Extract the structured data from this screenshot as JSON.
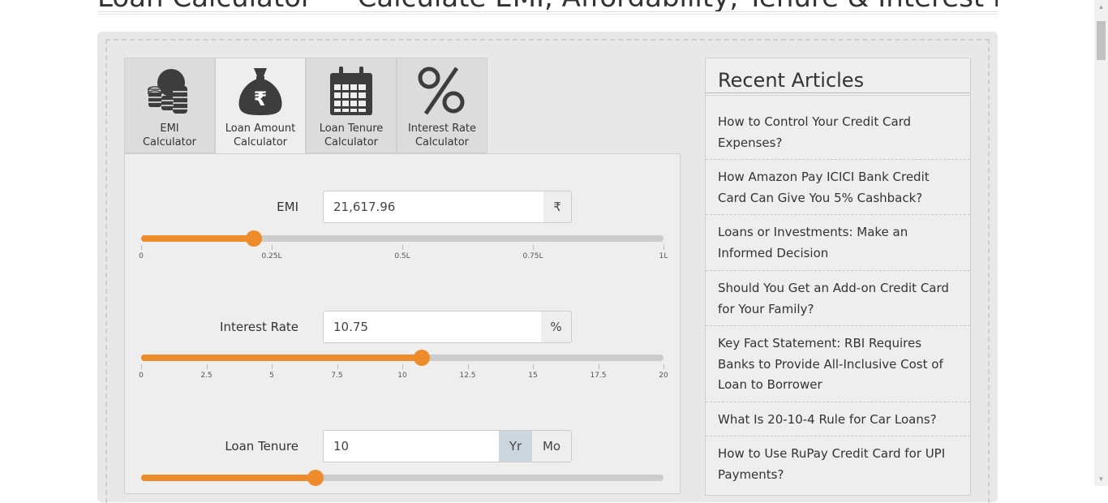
{
  "page": {
    "title": "Loan Calculator — Calculate EMI, Affordability, Tenure & Interest Rate"
  },
  "tabs": [
    {
      "label": "EMI\nCalculator",
      "icon": "coins-stack-icon",
      "active": false
    },
    {
      "label": "Loan Amount\nCalculator",
      "icon": "rupee-money-bag-icon",
      "active": true
    },
    {
      "label": "Loan Tenure\nCalculator",
      "icon": "calendar-icon",
      "active": false
    },
    {
      "label": "Interest Rate\nCalculator",
      "icon": "percent-icon",
      "active": false
    }
  ],
  "form": {
    "emi": {
      "label": "EMI",
      "value": "21,617.96",
      "unit": "₹",
      "slider": {
        "min": 0,
        "max": 100000,
        "value": 21617.96,
        "ticks": [
          "0",
          "0.25L",
          "0.5L",
          "0.75L",
          "1L"
        ]
      }
    },
    "interest_rate": {
      "label": "Interest Rate",
      "value": "10.75",
      "unit": "%",
      "slider": {
        "min": 0,
        "max": 20,
        "value": 10.75,
        "ticks": [
          "0",
          "2.5",
          "5",
          "7.5",
          "10",
          "12.5",
          "15",
          "17.5",
          "20"
        ]
      }
    },
    "loan_tenure": {
      "label": "Loan Tenure",
      "value": "10",
      "unit_year": "Yr",
      "unit_month": "Mo",
      "selected_unit": "Yr",
      "slider": {
        "min": 0,
        "max": 30,
        "value": 10
      }
    }
  },
  "sidebar": {
    "title": "Recent Articles",
    "articles": [
      "How to Control Your Credit Card Expenses?",
      "How Amazon Pay ICICI Bank Credit Card Can Give You 5% Cashback?",
      "Loans or Investments: Make an Informed Decision",
      "Should You Get an Add-on Credit Card for Your Family?",
      "Key Fact Statement: RBI Requires Banks to Provide All-Inclusive Cost of Loan to Borrower",
      "What Is 20-10-4 Rule for Car Loans?",
      "How to Use RuPay Credit Card for UPI Payments?"
    ]
  },
  "colors": {
    "accent": "#ee8c2b",
    "panel_bg": "#eeeeee",
    "selected_unit_bg": "#ccd6df"
  }
}
